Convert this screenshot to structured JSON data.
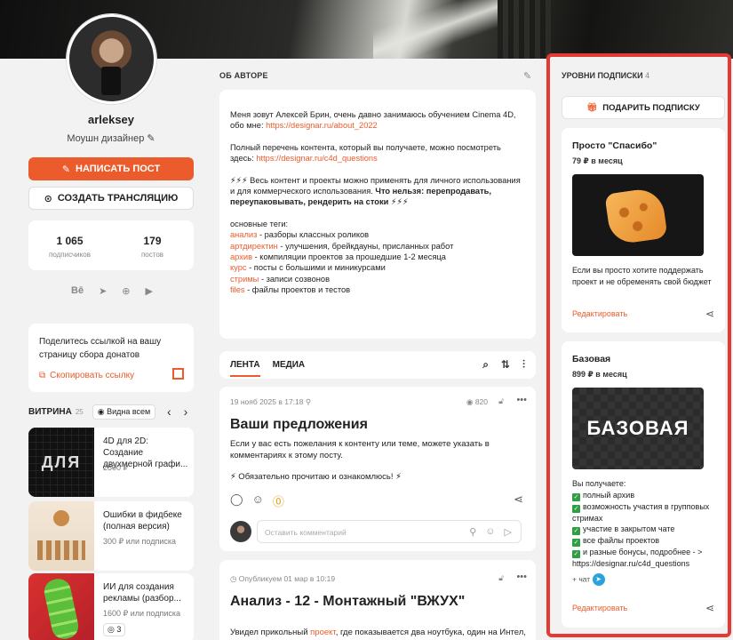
{
  "profile": {
    "username": "arleksey",
    "role": "Моушн дизайнер",
    "write_post": "НАПИСАТЬ ПОСТ",
    "start_stream": "СОЗДАТЬ ТРАНСЛЯЦИЮ",
    "subscribers_count": "1 065",
    "subscribers_label": "подписчиков",
    "posts_count": "179",
    "posts_label": "постов",
    "socials": [
      "Bē",
      "telegram-icon",
      "globe-icon",
      "youtube-icon"
    ],
    "donate_text": "Поделитесь ссылкой на вашу страницу сбора донатов",
    "copy_link": "Скопировать ссылку"
  },
  "showcase": {
    "title": "ВИТРИНА",
    "count": "25",
    "visibility": "Видна всем",
    "items": [
      {
        "title": "4D для 2D: Создание двухмерной графи...",
        "price": "2500 ₽"
      },
      {
        "title": "Ошибки в фидбеке (полная версия)",
        "price": "300 ₽ или подписка"
      },
      {
        "title": "ИИ для создания рекламы (разбор...",
        "price": "1600 ₽ или подписка",
        "badge": "3"
      }
    ],
    "thumb1_text": "ДЛЯ"
  },
  "about": {
    "title": "ОБ АВТОРЕ",
    "p1": "Меня зовут Алексей Брин, очень давно занимаюсь обучением Cinema 4D, обо мне: ",
    "p1_link": "https://designar.ru/about_2022",
    "p2": "Полный перечень контента, который вы получаете, можно посмотреть здесь: ",
    "p2_link": "https://designar.ru/c4d_questions",
    "p3_a": "⚡⚡⚡ Весь контент и проекты можно применять для личного использования и для коммерческого использования. ",
    "p3_b": "Что нельзя: перепродавать,  переупаковывать, рендерить на стоки",
    "p3_c": " ⚡⚡⚡",
    "tags_title": "основные теги:",
    "tags": [
      {
        "tag": "анализ",
        "desc": " - разборы классных роликов"
      },
      {
        "tag": "артдиректин",
        "desc": " - улучшения, брейкдауны, присланных работ"
      },
      {
        "tag": "архив",
        "desc": " - компиляции проектов за прошедшие 1-2 месяца"
      },
      {
        "tag": "курс",
        "desc": " - посты с большими и миникурсами"
      },
      {
        "tag": "стримы",
        "desc": " - записи созвонов"
      },
      {
        "tag": "files",
        "desc": " - файлы проектов и тестов"
      }
    ]
  },
  "feed": {
    "tab_feed": "ЛЕНТА",
    "tab_media": "МЕДИА",
    "post1": {
      "date": "19 нояб 2025 в 17:18",
      "views": "820",
      "title": "Ваши предложения",
      "text": "Если у вас есть пожелания к контенту или теме, можете указать в комментариях к этому посту.",
      "text2": "⚡ Обязательно прочитаю и ознакомлюсь! ⚡",
      "comment_placeholder": "Оставить комментарий"
    },
    "post2": {
      "date": "Опубликуем 01 мар в 10:19",
      "title": "Анализ - 12 - Монтажный \"ВЖУХ\"",
      "text_a": "Увидел прикольный ",
      "text_link": "проект",
      "text_b": ", где показывается два ноутбука, один на Интел,"
    }
  },
  "tiers": {
    "title": "УРОВНИ ПОДПИСКИ",
    "count": "4",
    "gift": "ПОДАРИТЬ ПОДПИСКУ",
    "items": [
      {
        "name": "Просто \"Спасибо\"",
        "price": "79 ₽ в месяц",
        "desc": "Если вы просто хотите поддержать проект и не обременять свой бюджет",
        "edit": "Редактировать"
      },
      {
        "name": "Базовая",
        "price": "899 ₽ в месяц",
        "image_text": "БАЗОВАЯ",
        "you_get": "Вы получаете:",
        "benefits": [
          "полный архив",
          "возможность участия в групповых стримах",
          "участие в закрытом чате",
          "все файлы проектов",
          "и разные бонусы, подробнее - > https://designar.ru/c4d_questions"
        ],
        "chat": "+ чат",
        "edit": "Редактировать"
      }
    ]
  },
  "colors": {
    "accent": "#ec5b2b",
    "highlight_border": "#e53935"
  }
}
